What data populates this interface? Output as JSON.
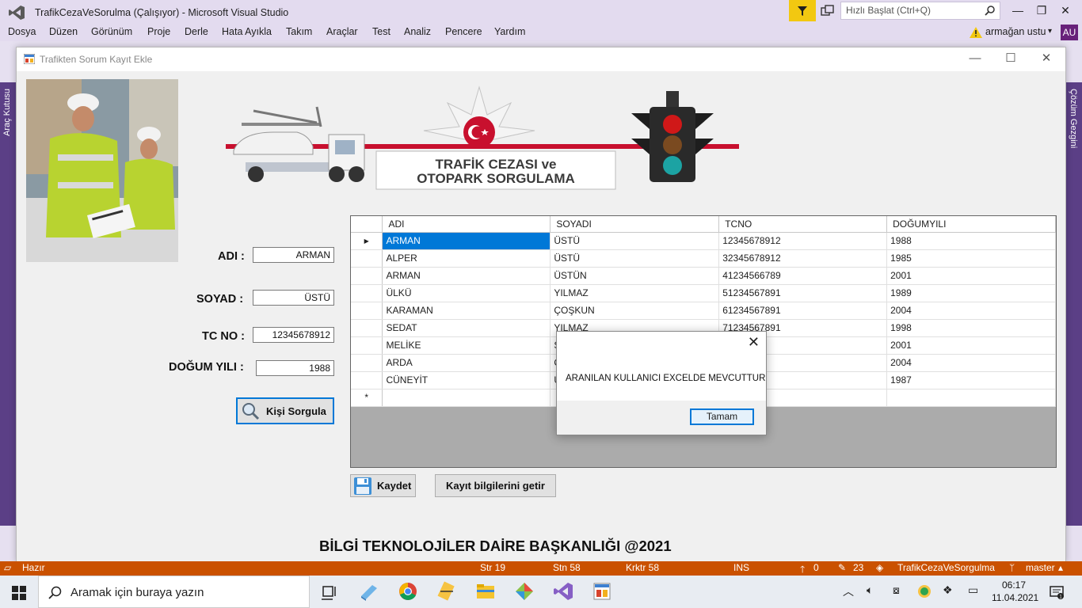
{
  "vs": {
    "title": "TrafikCezaVeSorulma (Çalışıyor) - Microsoft Visual Studio",
    "quick_launch_placeholder": "Hızlı Başlat (Ctrl+Q)",
    "menu": [
      "Dosya",
      "Düzen",
      "Görünüm",
      "Proje",
      "Derle",
      "Hata Ayıkla",
      "Takım",
      "Araçlar",
      "Test",
      "Analiz",
      "Pencere",
      "Yardım"
    ],
    "user": "armağan ustu",
    "avatar_initials": "AU",
    "left_side_tab": "Araç Kutusu",
    "right_side_tab": "Çözüm Gezgini"
  },
  "form": {
    "title": "Trafikten Sorum Kayıt Ekle",
    "banner_line1": "TRAFİK CEZASI ve",
    "banner_line2": "OTOPARK SORGULAMA",
    "fields": {
      "adi_label": "ADI :",
      "adi_value": "ARMAN",
      "soyad_label": "SOYAD :",
      "soyad_value": "ÜSTÜ",
      "tc_label": "TC NO :",
      "tc_value": "12345678912",
      "dogum_label": "DOĞUM YILI :",
      "dogum_value": "1988"
    },
    "buttons": {
      "kisi_sorgula": "Kişi Sorgula",
      "kaydet": "Kaydet",
      "kayit_getir": "Kayıt bilgilerini getir"
    },
    "grid": {
      "columns": [
        "ADI",
        "SOYADI",
        "TCNO",
        "DOĞUMYILI"
      ],
      "rows": [
        [
          "ARMAN",
          "ÜSTÜ",
          "12345678912",
          "1988"
        ],
        [
          "ALPER",
          "ÜSTÜ",
          "32345678912",
          "1985"
        ],
        [
          "ARMAN",
          "ÜSTÜN",
          "41234566789",
          "2001"
        ],
        [
          "ÜLKÜ",
          "YILMAZ",
          "51234567891",
          "1989"
        ],
        [
          "KARAMAN",
          "ÇOŞKUN",
          "61234567891",
          "2004"
        ],
        [
          "SEDAT",
          "YILMAZ",
          "71234567891",
          "1998"
        ],
        [
          "MELİKE",
          "S",
          "91",
          "2001"
        ],
        [
          "ARDA",
          "Ç",
          "89",
          "2004"
        ],
        [
          "CÜNEYİT",
          "Ü",
          "91",
          "1987"
        ]
      ],
      "new_row_marker": "*",
      "current_row_marker": "▶"
    },
    "footer": "BİLGİ TEKNOLOJİLER DAİRE BAŞKANLIĞI @2021"
  },
  "dialog": {
    "message": "ARANILAN KULLANICI EXCELDE MEVCUTTUR",
    "ok": "Tamam"
  },
  "status": {
    "ready": "Hazır",
    "line": "Str 19",
    "col": "Stn 58",
    "ch": "Krktr 58",
    "mode": "INS",
    "up": "0",
    "edits": "23",
    "project": "TrafikCezaVeSorgulma",
    "branch": "master"
  },
  "taskbar": {
    "search_placeholder": "Aramak için buraya yazın",
    "time": "06:17",
    "date": "11.04.2021"
  },
  "colors": {
    "vs_purple": "#68217a",
    "status_orange": "#ca5100",
    "selection_blue": "#0078d7",
    "banner_red": "#c8102e"
  }
}
